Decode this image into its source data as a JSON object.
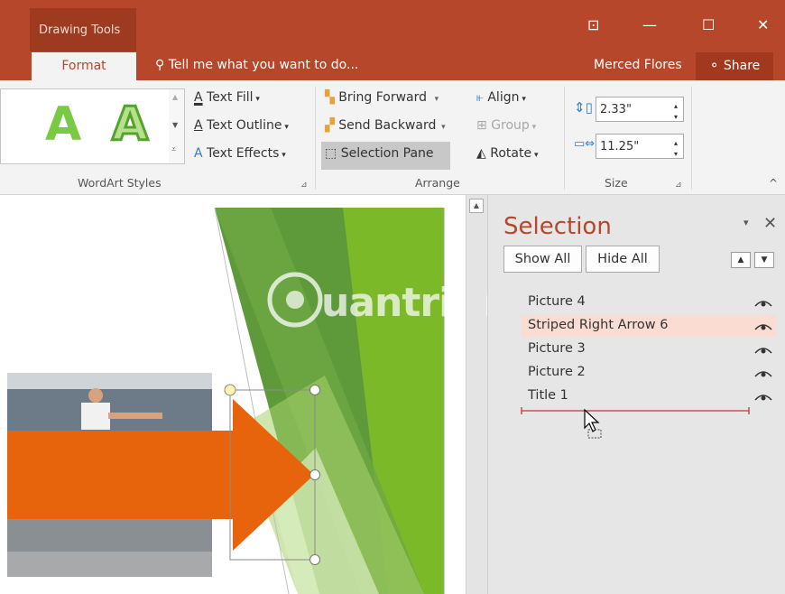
{
  "titlebar": {
    "context_tab": "Drawing Tools",
    "window_buttons": [
      "⊡",
      "—",
      "☐",
      "✕"
    ]
  },
  "tabs": {
    "active": "Format",
    "tell_me": "Tell me what you want to do...",
    "user": "Merced Flores",
    "share": "Share"
  },
  "ribbon": {
    "wordart": {
      "text_fill": "Text Fill",
      "text_outline": "Text Outline",
      "text_effects": "Text Effects",
      "group_label": "WordArt Styles",
      "sample_glyph": "A"
    },
    "arrange": {
      "bring_forward": "Bring Forward",
      "send_backward": "Send Backward",
      "selection_pane": "Selection Pane",
      "align": "Align",
      "group": "Group",
      "rotate": "Rotate",
      "group_label": "Arrange"
    },
    "size": {
      "height": "2.33\"",
      "width": "11.25\"",
      "group_label": "Size"
    }
  },
  "selection_pane": {
    "title": "Selection",
    "show_all": "Show All",
    "hide_all": "Hide All",
    "items": [
      "Picture 4",
      "Striped Right Arrow 6",
      "Picture 3",
      "Picture 2",
      "Title 1"
    ],
    "selected_index": 1
  },
  "watermark": "uantrimang",
  "colors": {
    "accent": "#b7472a",
    "arrow": "#e8640c",
    "green": "#6aa32a",
    "selected_row": "#fbdcd2"
  }
}
